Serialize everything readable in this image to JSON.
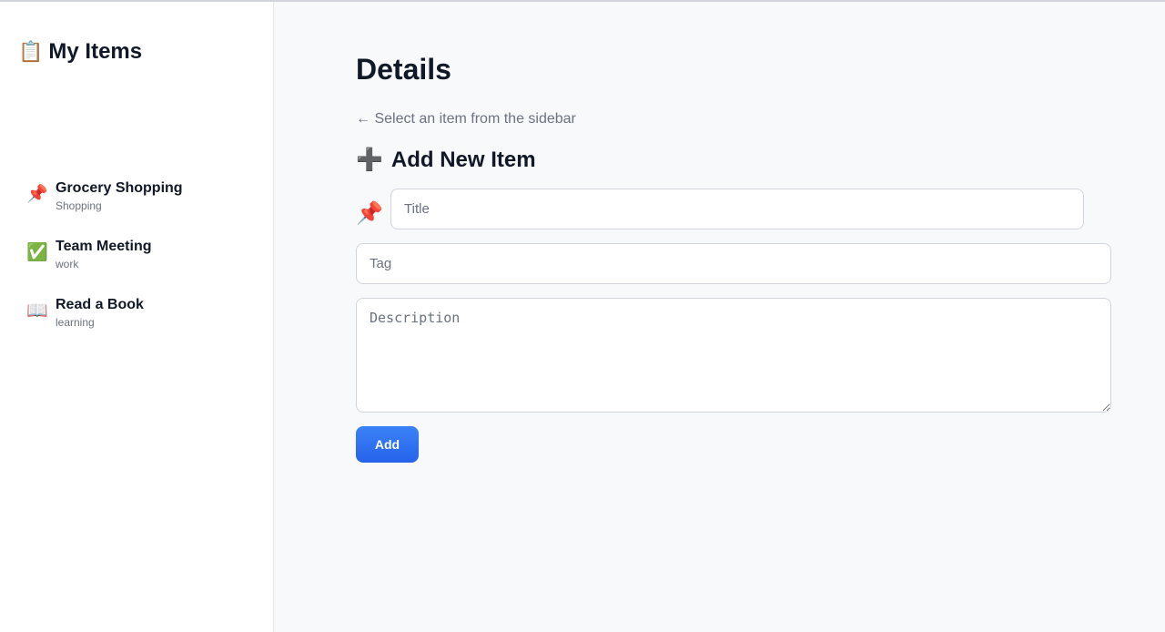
{
  "sidebar": {
    "title_icon": "📋",
    "title": "My Items",
    "items": [
      {
        "icon": "📌",
        "icon_name": "pushpin-icon",
        "title": "Grocery Shopping",
        "tag": "Shopping"
      },
      {
        "icon": "✅",
        "icon_name": "check-mark-icon",
        "title": "Team Meeting",
        "tag": "work"
      },
      {
        "icon": "📖",
        "icon_name": "open-book-icon",
        "title": "Read a Book",
        "tag": "learning"
      }
    ]
  },
  "main": {
    "title": "Details",
    "hint": "← Select an item from the sidebar",
    "form": {
      "heading_icon": "➕",
      "heading": "Add New Item",
      "emoji_icon": "📌",
      "title_placeholder": "Title",
      "tag_placeholder": "Tag",
      "description_placeholder": "Description",
      "submit_label": "Add"
    }
  },
  "colors": {
    "accent": "#2563eb",
    "sidebar_bg": "#ffffff",
    "main_bg": "#f8f9fb",
    "muted_text": "#6b7280"
  }
}
